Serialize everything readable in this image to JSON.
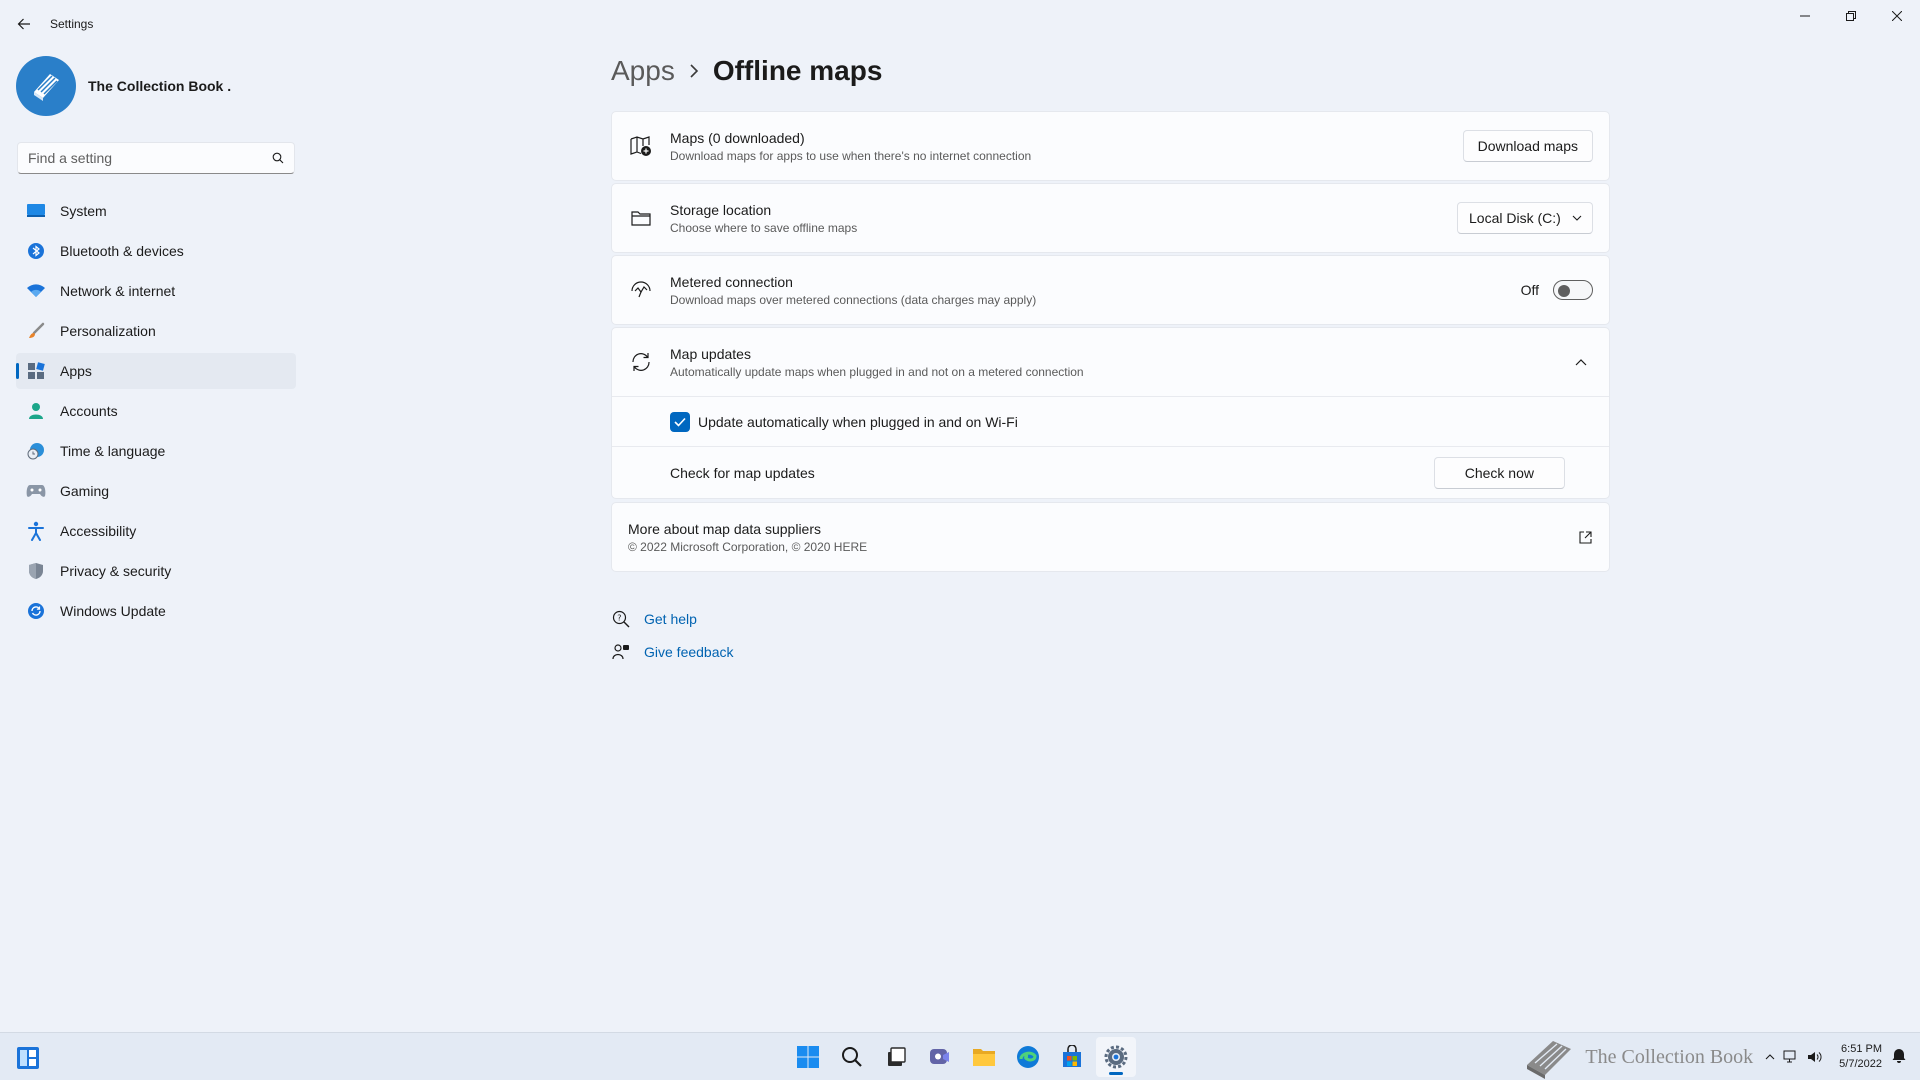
{
  "window": {
    "title": "Settings"
  },
  "profile": {
    "name": "The Collection Book ."
  },
  "search": {
    "placeholder": "Find a setting"
  },
  "sidebar": {
    "items": [
      {
        "label": "System",
        "icon": "system-icon"
      },
      {
        "label": "Bluetooth & devices",
        "icon": "bluetooth-icon"
      },
      {
        "label": "Network & internet",
        "icon": "wifi-icon"
      },
      {
        "label": "Personalization",
        "icon": "brush-icon"
      },
      {
        "label": "Apps",
        "icon": "apps-icon",
        "selected": true
      },
      {
        "label": "Accounts",
        "icon": "person-icon"
      },
      {
        "label": "Time & language",
        "icon": "clock-globe-icon"
      },
      {
        "label": "Gaming",
        "icon": "gamepad-icon"
      },
      {
        "label": "Accessibility",
        "icon": "accessibility-icon"
      },
      {
        "label": "Privacy & security",
        "icon": "shield-icon"
      },
      {
        "label": "Windows Update",
        "icon": "update-icon"
      }
    ]
  },
  "breadcrumb": {
    "parent": "Apps",
    "current": "Offline maps"
  },
  "maps": {
    "title": "Maps (0 downloaded)",
    "description": "Download maps for apps to use when there's no internet connection",
    "button": "Download maps"
  },
  "storage": {
    "title": "Storage location",
    "description": "Choose where to save offline maps",
    "selected": "Local Disk (C:)"
  },
  "metered": {
    "title": "Metered connection",
    "description": "Download maps over metered connections (data charges may apply)",
    "state_label": "Off",
    "enabled": false
  },
  "updates": {
    "title": "Map updates",
    "description": "Automatically update maps when plugged in and not on a metered connection",
    "expanded": true,
    "auto_update_label": "Update automatically when plugged in and on Wi-Fi",
    "auto_update_checked": true,
    "check_label": "Check for map updates",
    "check_button": "Check now"
  },
  "suppliers": {
    "title": "More about map data suppliers",
    "copyright": "© 2022 Microsoft Corporation, © 2020 HERE"
  },
  "help": {
    "get_help": "Get help",
    "give_feedback": "Give feedback"
  },
  "taskbar": {
    "watermark": "The Collection Book",
    "time": "6:51 PM",
    "date": "5/7/2022"
  },
  "colors": {
    "accent": "#0067c0",
    "link": "#0063b1",
    "background": "#eef2f9",
    "card": "#fbfcfe"
  }
}
